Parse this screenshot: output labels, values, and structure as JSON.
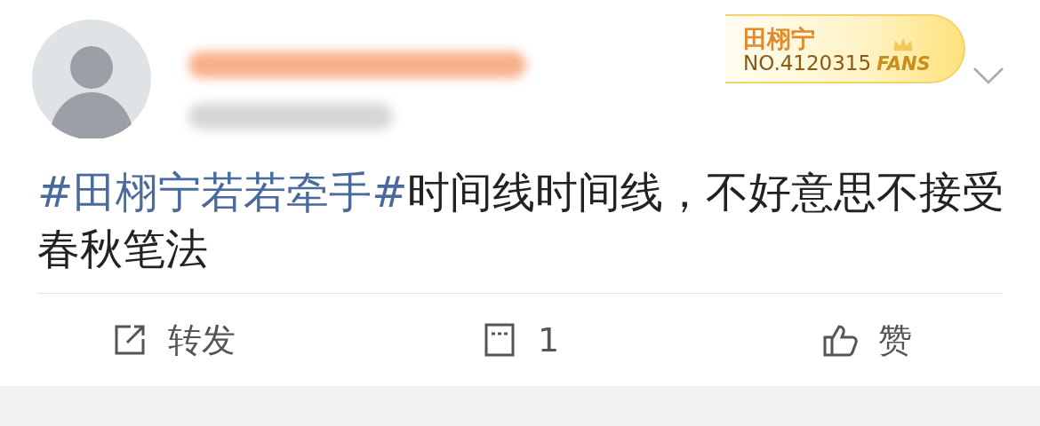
{
  "post": {
    "fan_badge": {
      "name": "田栩宁",
      "number": "NO.4120315",
      "tag": "FANS"
    },
    "hashtag": "#田栩宁若若牵手#",
    "text": "时间线时间线，不好意思不接受春秋笔法"
  },
  "actions": [
    {
      "kind": "repost",
      "label": "转发"
    },
    {
      "kind": "comment",
      "label": "1"
    },
    {
      "kind": "like",
      "label": "赞"
    }
  ]
}
